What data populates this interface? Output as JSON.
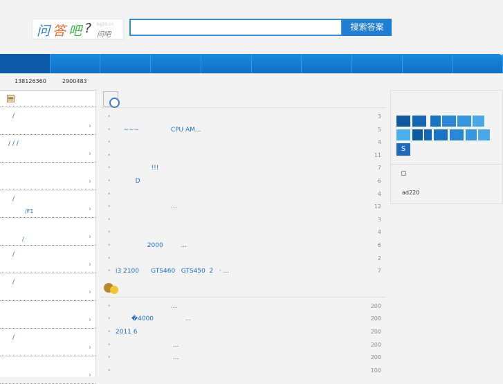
{
  "logo": {
    "chars": [
      "问",
      "答",
      "吧",
      "?"
    ],
    "domain": "bg20.cn",
    "sub": "问吧"
  },
  "search": {
    "value": "",
    "placeholder": "",
    "button": "搜索答案"
  },
  "nav": {
    "active_index": 0,
    "count": 10
  },
  "stats": {
    "a": "138126360",
    "b": "2900483"
  },
  "sidebar": {
    "categories": [
      {
        "t1": "/",
        "t2": ""
      },
      {
        "t1": "/    /    /",
        "t2": ""
      },
      {
        "t1": "",
        "t2": ""
      },
      {
        "t1": "/",
        "t2": "/F1"
      },
      {
        "t1": "",
        "t2": "/"
      },
      {
        "t1": "/",
        "t2": ""
      },
      {
        "t1": "/",
        "t2": ""
      },
      {
        "t1": "",
        "t2": ""
      },
      {
        "t1": "/",
        "t2": ""
      },
      {
        "t1": "",
        "t2": ""
      }
    ]
  },
  "latest": {
    "items": [
      {
        "text": "",
        "count": "3"
      },
      {
        "text": "    ~~~                CPU AM...",
        "count": "5"
      },
      {
        "text": "",
        "count": "4"
      },
      {
        "text": "",
        "count": "11"
      },
      {
        "text": "                  !!!",
        "count": "7"
      },
      {
        "text": "          D",
        "count": "6"
      },
      {
        "text": "",
        "count": "4"
      },
      {
        "text": "                            ...",
        "count": "12"
      },
      {
        "text": "",
        "count": "3"
      },
      {
        "text": "",
        "count": "4"
      },
      {
        "text": "                2000         ...",
        "count": "6"
      },
      {
        "text": "",
        "count": "2"
      },
      {
        "text": "i3 2100      GTS460   GTS450  2   · ...",
        "count": "7"
      }
    ]
  },
  "reward": {
    "items": [
      {
        "text": "                            ...",
        "count": "200"
      },
      {
        "text": "        �4000                ...",
        "count": "200"
      },
      {
        "text": "2011 6",
        "count": "200"
      },
      {
        "text": "                             ...",
        "count": "200"
      },
      {
        "text": "                             ...",
        "count": "200"
      },
      {
        "text": "",
        "count": "100"
      }
    ]
  },
  "right": {
    "tile_letter": "S",
    "user": "ad220"
  },
  "colors": {
    "nav": "#1a7fd4",
    "link": "#1e6fc0"
  }
}
